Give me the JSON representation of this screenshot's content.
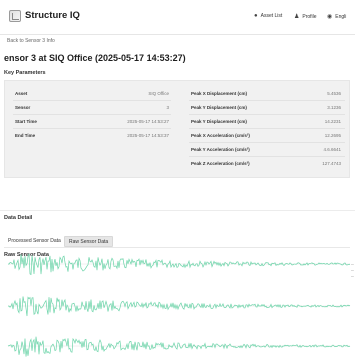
{
  "app": {
    "title": "Structure IQ"
  },
  "nav": {
    "asset_list": "Asset List",
    "profile": "Profile",
    "language": "Engli"
  },
  "breadcrumb": "Back to Sensor 3 Info",
  "page_title": "ensor 3 at SIQ Office (2025-05-17 14:53:27)",
  "key_parameters": {
    "heading": "Key Parameters",
    "left": [
      {
        "label": "Asset",
        "value": "SIQ Office"
      },
      {
        "label": "Sensor",
        "value": "3"
      },
      {
        "label": "Start Time",
        "value": "2025-05-17 14:53:27"
      },
      {
        "label": "End Time",
        "value": "2025-05-17 14:53:37"
      }
    ],
    "right": [
      {
        "label": "Peak X Displacement (cm)",
        "value": "5.4536"
      },
      {
        "label": "Peak Y Displacement (cm)",
        "value": "3.1236"
      },
      {
        "label": "Peak Y Displacement (cm)",
        "value": "14.2231"
      },
      {
        "label": "Peak X Acceleration (cm/s²)",
        "value": "12.2695"
      },
      {
        "label": "Peak Y Acceleration (cm/s²)",
        "value": "4.6.6641"
      },
      {
        "label": "Peak Z Acceleration (cm/s²)",
        "value": "127.4743"
      }
    ]
  },
  "data_detail": {
    "heading": "Data Detail"
  },
  "tabs": [
    "Processed Sensor Data",
    "Raw Sensor Data"
  ],
  "raw_sensor_data": {
    "heading": "Raw Sensor Data"
  },
  "waveform_color": "#69d3a7"
}
